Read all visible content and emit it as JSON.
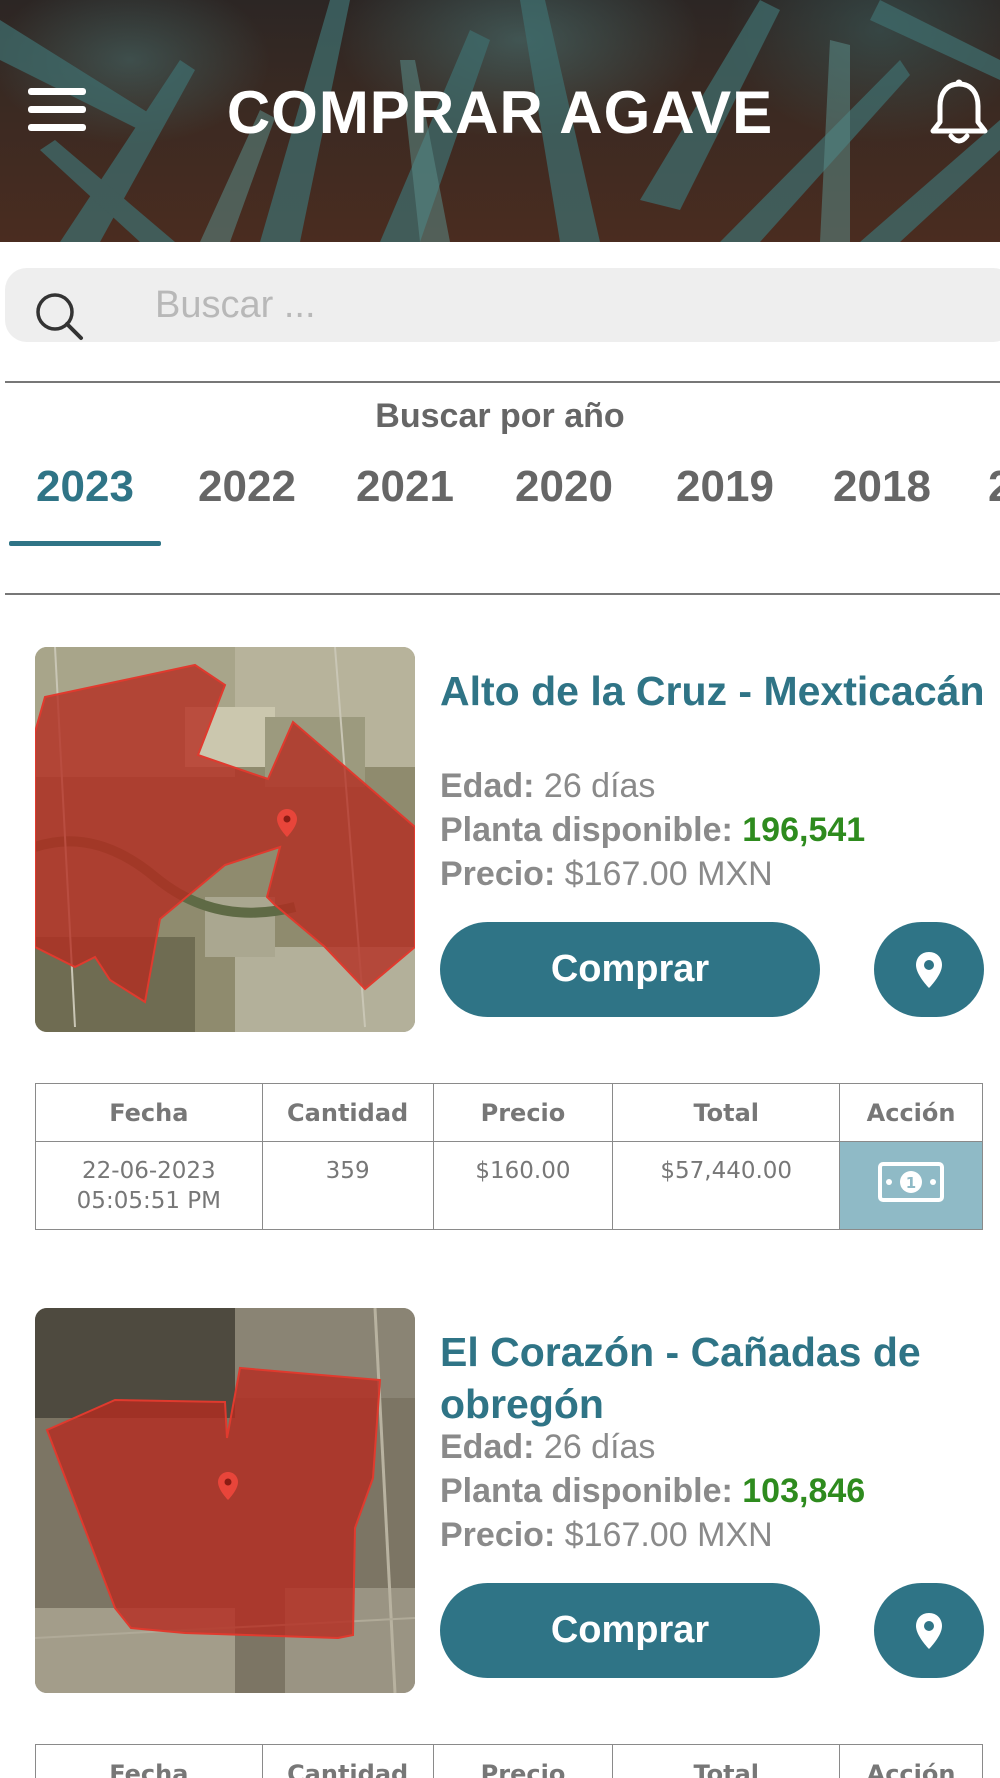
{
  "header": {
    "title": "COMPRAR AGAVE",
    "menu_icon": "hamburger-menu-icon",
    "bell_icon": "bell-icon"
  },
  "search": {
    "placeholder": "Buscar ..."
  },
  "year_filter": {
    "label": "Buscar por año",
    "tabs": [
      "2023",
      "2022",
      "2021",
      "2020",
      "2019",
      "2018",
      "2"
    ],
    "selected": "2023"
  },
  "table_headers": [
    "Fecha",
    "Cantidad",
    "Precio",
    "Total",
    "Acción"
  ],
  "listings": [
    {
      "title": "Alto de la Cruz - Mexticacán",
      "edad_label": "Edad:",
      "edad_value": "26 días",
      "planta_label": "Planta disponible:",
      "planta_value": "196,541",
      "precio_label": "Precio:",
      "precio_value": "$167.00 MXN",
      "buy_label": "Comprar",
      "rows": [
        {
          "fecha": "22-06-2023",
          "hora": "05:05:51 PM",
          "cantidad": "359",
          "precio": "$160.00",
          "total": "$57,440.00"
        }
      ]
    },
    {
      "title": "El Corazón - Cañadas de obregón",
      "edad_label": "Edad:",
      "edad_value": "26 días",
      "planta_label": "Planta disponible:",
      "planta_value": "103,846",
      "precio_label": "Precio:",
      "precio_value": "$167.00 MXN",
      "buy_label": "Comprar"
    }
  ],
  "colors": {
    "accent": "#2f7486",
    "available_green": "#2e8b1e",
    "action_cell": "#8fbac6",
    "parcel_red": "#c0392b"
  }
}
